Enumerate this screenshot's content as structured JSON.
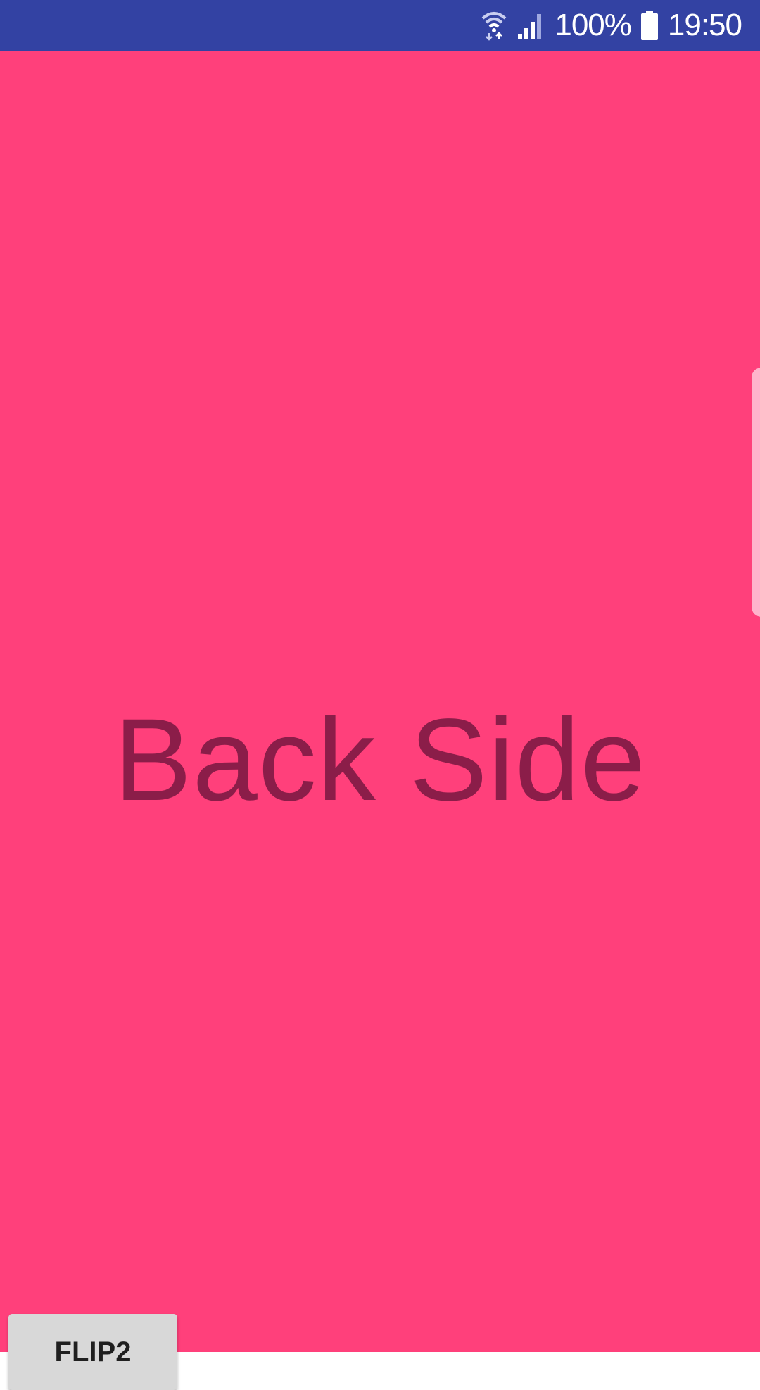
{
  "status_bar": {
    "battery_percent": "100%",
    "time": "19:50",
    "background_color": "#3342A3",
    "icons": [
      "wifi-icon",
      "signal-icon",
      "battery-icon"
    ]
  },
  "main": {
    "background_color": "#FF407B",
    "title": "Back Side",
    "title_color": "#8B1D49"
  },
  "flip_button": {
    "label": "FLIP2"
  }
}
